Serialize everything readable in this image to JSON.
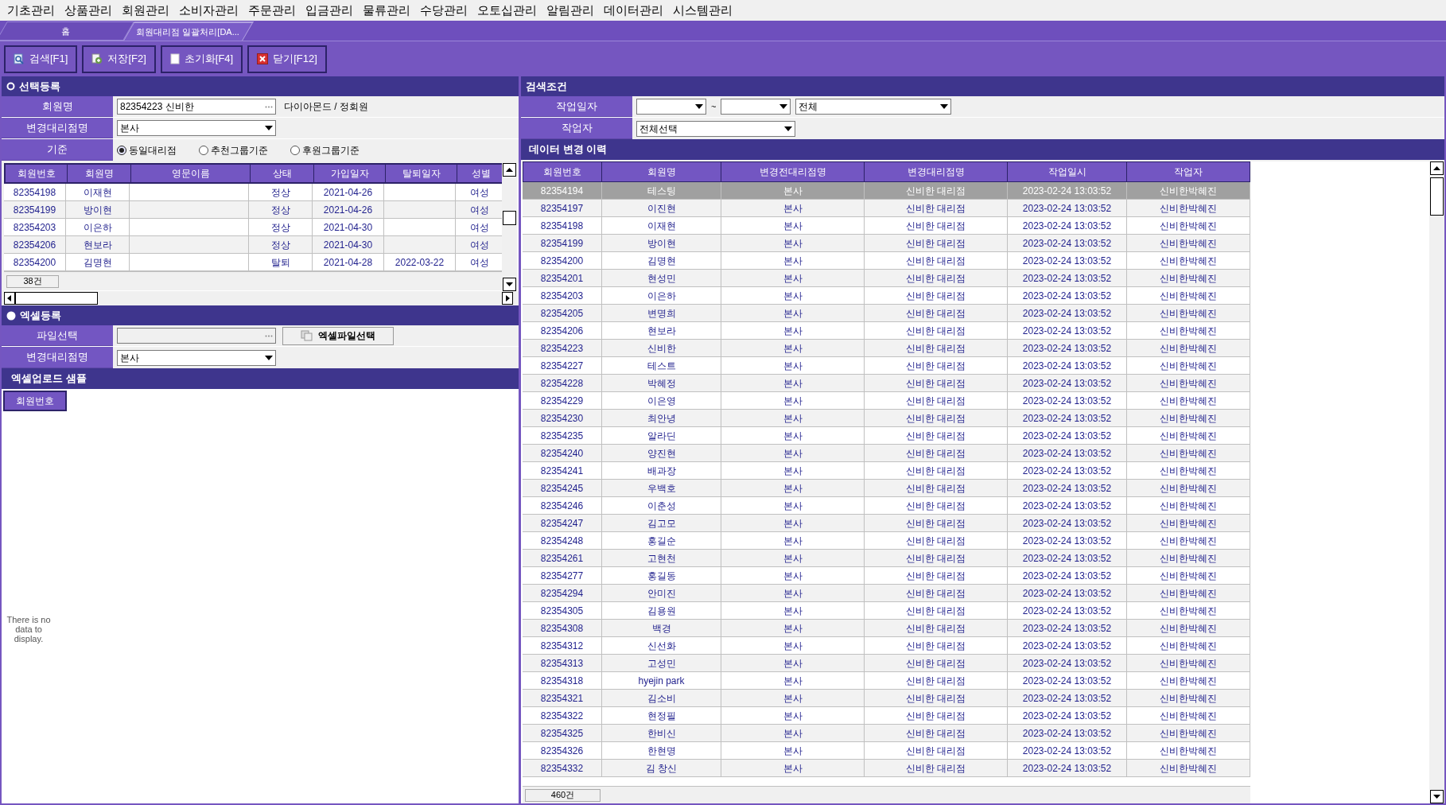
{
  "menu": [
    "기초관리",
    "상품관리",
    "회원관리",
    "소비자관리",
    "주문관리",
    "입금관리",
    "물류관리",
    "수당관리",
    "오토십관리",
    "알림관리",
    "데이터관리",
    "시스템관리"
  ],
  "tabs": [
    {
      "label": "홈",
      "selected": false
    },
    {
      "label": "회원대리점 일괄처리[DA...",
      "selected": true
    }
  ],
  "toolbar": [
    {
      "kind": "search",
      "label": "검색[F1]"
    },
    {
      "kind": "save",
      "label": "저장[F2]"
    },
    {
      "kind": "reset",
      "label": "초기화[F4]"
    },
    {
      "kind": "close",
      "label": "닫기[F12]"
    }
  ],
  "select_panel": {
    "title": "선택등록",
    "member_label": "회원명",
    "member_value": "82354223 신비한",
    "member_grade": "다이아몬드 / 정회원",
    "agency_label": "변경대리점명",
    "agency_value": "본사",
    "basis_label": "기준",
    "basis_options": [
      {
        "label": "동일대리점",
        "selected": true
      },
      {
        "label": "추천그룹기준",
        "selected": false
      },
      {
        "label": "후원그룹기준",
        "selected": false
      }
    ],
    "table": {
      "columns": [
        "회원번호",
        "회원명",
        "영문이름",
        "상태",
        "가입일자",
        "탈퇴일자",
        "성별"
      ],
      "rows": [
        [
          "82354198",
          "이재현",
          "",
          "정상",
          "2021-04-26",
          "",
          "여성"
        ],
        [
          "82354199",
          "방이현",
          "",
          "정상",
          "2021-04-26",
          "",
          "여성"
        ],
        [
          "82354203",
          "이은하",
          "",
          "정상",
          "2021-04-30",
          "",
          "여성"
        ],
        [
          "82354206",
          "현보라",
          "",
          "정상",
          "2021-04-30",
          "",
          "여성"
        ],
        [
          "82354200",
          "김명현",
          "",
          "탈퇴",
          "2021-04-28",
          "2022-03-22",
          "여성"
        ]
      ],
      "count": "38건"
    }
  },
  "excel_panel": {
    "title": "엑셀등록",
    "file_label": "파일선택",
    "file_button": "엑셀파일선택",
    "agency_label": "변경대리점명",
    "agency_value": "본사",
    "sample_title": "엑셀업로드 샘플",
    "sample_column": "회원번호",
    "empty_text": "There is no data to display."
  },
  "search_panel": {
    "title": "검색조건",
    "date_label": "작업일자",
    "date_separator": "~",
    "date_scope": "전체",
    "worker_label": "작업자",
    "worker_value": "전체선택"
  },
  "history": {
    "title": "데이터 변경 이력",
    "columns": [
      "회원번호",
      "회원명",
      "변경전대리점명",
      "변경대리점명",
      "작업일시",
      "작업자"
    ],
    "rows": [
      {
        "selected": true,
        "cells": [
          "82354194",
          "테스팅",
          "본사",
          "신비한 대리점",
          "2023-02-24 13:03:52",
          "신비한박혜진"
        ]
      },
      {
        "selected": false,
        "cells": [
          "82354197",
          "이진현",
          "본사",
          "신비한 대리점",
          "2023-02-24 13:03:52",
          "신비한박혜진"
        ]
      },
      {
        "selected": false,
        "cells": [
          "82354198",
          "이재현",
          "본사",
          "신비한 대리점",
          "2023-02-24 13:03:52",
          "신비한박혜진"
        ]
      },
      {
        "selected": false,
        "cells": [
          "82354199",
          "방이현",
          "본사",
          "신비한 대리점",
          "2023-02-24 13:03:52",
          "신비한박혜진"
        ]
      },
      {
        "selected": false,
        "cells": [
          "82354200",
          "김명현",
          "본사",
          "신비한 대리점",
          "2023-02-24 13:03:52",
          "신비한박혜진"
        ]
      },
      {
        "selected": false,
        "cells": [
          "82354201",
          "현성민",
          "본사",
          "신비한 대리점",
          "2023-02-24 13:03:52",
          "신비한박혜진"
        ]
      },
      {
        "selected": false,
        "cells": [
          "82354203",
          "이은하",
          "본사",
          "신비한 대리점",
          "2023-02-24 13:03:52",
          "신비한박혜진"
        ]
      },
      {
        "selected": false,
        "cells": [
          "82354205",
          "변명희",
          "본사",
          "신비한 대리점",
          "2023-02-24 13:03:52",
          "신비한박혜진"
        ]
      },
      {
        "selected": false,
        "cells": [
          "82354206",
          "현보라",
          "본사",
          "신비한 대리점",
          "2023-02-24 13:03:52",
          "신비한박혜진"
        ]
      },
      {
        "selected": false,
        "cells": [
          "82354223",
          "신비한",
          "본사",
          "신비한 대리점",
          "2023-02-24 13:03:52",
          "신비한박혜진"
        ]
      },
      {
        "selected": false,
        "cells": [
          "82354227",
          "테스트",
          "본사",
          "신비한 대리점",
          "2023-02-24 13:03:52",
          "신비한박혜진"
        ]
      },
      {
        "selected": false,
        "cells": [
          "82354228",
          "박혜정",
          "본사",
          "신비한 대리점",
          "2023-02-24 13:03:52",
          "신비한박혜진"
        ]
      },
      {
        "selected": false,
        "cells": [
          "82354229",
          "이은영",
          "본사",
          "신비한 대리점",
          "2023-02-24 13:03:52",
          "신비한박혜진"
        ]
      },
      {
        "selected": false,
        "cells": [
          "82354230",
          "최안녕",
          "본사",
          "신비한 대리점",
          "2023-02-24 13:03:52",
          "신비한박혜진"
        ]
      },
      {
        "selected": false,
        "cells": [
          "82354235",
          "알라딘",
          "본사",
          "신비한 대리점",
          "2023-02-24 13:03:52",
          "신비한박혜진"
        ]
      },
      {
        "selected": false,
        "cells": [
          "82354240",
          "양진현",
          "본사",
          "신비한 대리점",
          "2023-02-24 13:03:52",
          "신비한박혜진"
        ]
      },
      {
        "selected": false,
        "cells": [
          "82354241",
          "배과장",
          "본사",
          "신비한 대리점",
          "2023-02-24 13:03:52",
          "신비한박혜진"
        ]
      },
      {
        "selected": false,
        "cells": [
          "82354245",
          "우백호",
          "본사",
          "신비한 대리점",
          "2023-02-24 13:03:52",
          "신비한박혜진"
        ]
      },
      {
        "selected": false,
        "cells": [
          "82354246",
          "이춘성",
          "본사",
          "신비한 대리점",
          "2023-02-24 13:03:52",
          "신비한박혜진"
        ]
      },
      {
        "selected": false,
        "cells": [
          "82354247",
          "김고모",
          "본사",
          "신비한 대리점",
          "2023-02-24 13:03:52",
          "신비한박혜진"
        ]
      },
      {
        "selected": false,
        "cells": [
          "82354248",
          "홍길순",
          "본사",
          "신비한 대리점",
          "2023-02-24 13:03:52",
          "신비한박혜진"
        ]
      },
      {
        "selected": false,
        "cells": [
          "82354261",
          "고현천",
          "본사",
          "신비한 대리점",
          "2023-02-24 13:03:52",
          "신비한박혜진"
        ]
      },
      {
        "selected": false,
        "cells": [
          "82354277",
          "홍길동",
          "본사",
          "신비한 대리점",
          "2023-02-24 13:03:52",
          "신비한박혜진"
        ]
      },
      {
        "selected": false,
        "cells": [
          "82354294",
          "안미진",
          "본사",
          "신비한 대리점",
          "2023-02-24 13:03:52",
          "신비한박혜진"
        ]
      },
      {
        "selected": false,
        "cells": [
          "82354305",
          "김용원",
          "본사",
          "신비한 대리점",
          "2023-02-24 13:03:52",
          "신비한박혜진"
        ]
      },
      {
        "selected": false,
        "cells": [
          "82354308",
          "백경",
          "본사",
          "신비한 대리점",
          "2023-02-24 13:03:52",
          "신비한박혜진"
        ]
      },
      {
        "selected": false,
        "cells": [
          "82354312",
          "신선화",
          "본사",
          "신비한 대리점",
          "2023-02-24 13:03:52",
          "신비한박혜진"
        ]
      },
      {
        "selected": false,
        "cells": [
          "82354313",
          "고성민",
          "본사",
          "신비한 대리점",
          "2023-02-24 13:03:52",
          "신비한박혜진"
        ]
      },
      {
        "selected": false,
        "cells": [
          "82354318",
          "hyejin park",
          "본사",
          "신비한 대리점",
          "2023-02-24 13:03:52",
          "신비한박혜진"
        ]
      },
      {
        "selected": false,
        "cells": [
          "82354321",
          "김소비",
          "본사",
          "신비한 대리점",
          "2023-02-24 13:03:52",
          "신비한박혜진"
        ]
      },
      {
        "selected": false,
        "cells": [
          "82354322",
          "현정필",
          "본사",
          "신비한 대리점",
          "2023-02-24 13:03:52",
          "신비한박혜진"
        ]
      },
      {
        "selected": false,
        "cells": [
          "82354325",
          "한비신",
          "본사",
          "신비한 대리점",
          "2023-02-24 13:03:52",
          "신비한박혜진"
        ]
      },
      {
        "selected": false,
        "cells": [
          "82354326",
          "한현명",
          "본사",
          "신비한 대리점",
          "2023-02-24 13:03:52",
          "신비한박혜진"
        ]
      },
      {
        "selected": false,
        "cells": [
          "82354332",
          "김 창신",
          "본사",
          "신비한 대리점",
          "2023-02-24 13:03:52",
          "신비한박혜진"
        ]
      }
    ],
    "count": "460건"
  }
}
